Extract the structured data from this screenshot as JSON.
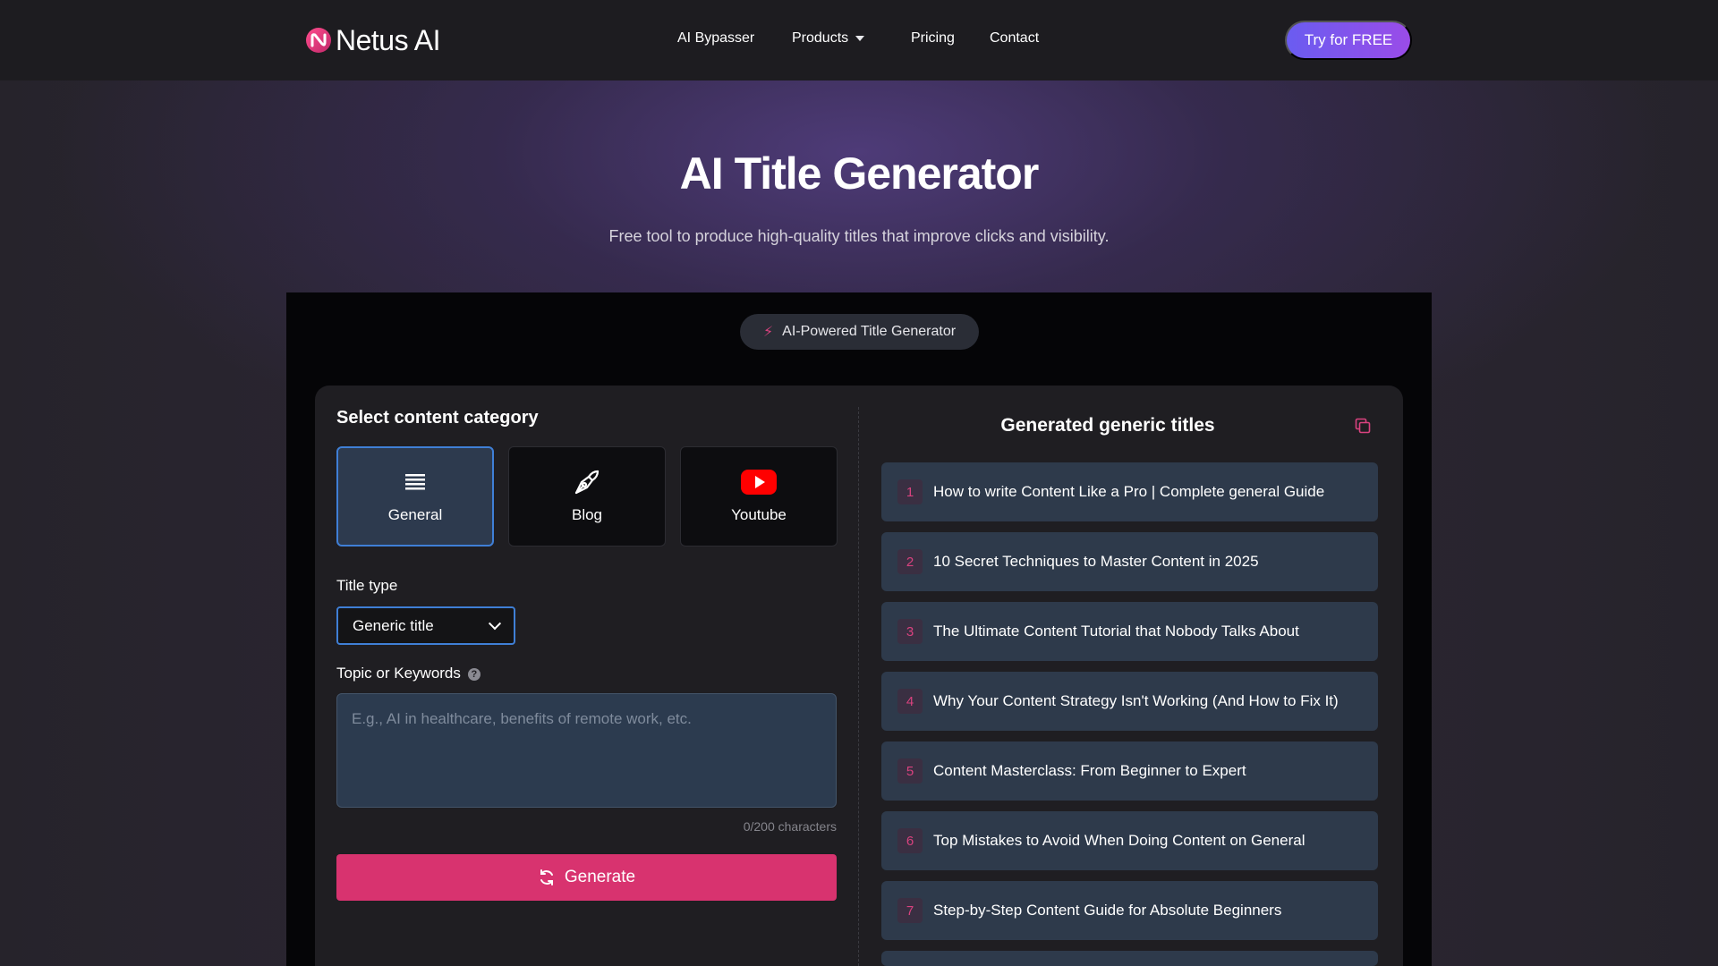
{
  "nav": {
    "brand": "Netus",
    "brand_suffix": "AI",
    "links": [
      "AI Bypasser",
      "Products",
      "Pricing",
      "Contact"
    ],
    "cta": "Try for FREE"
  },
  "hero": {
    "title": "AI Title Generator",
    "subtitle": "Free tool to produce high-quality titles that improve clicks and visibility."
  },
  "badge": {
    "icon": "bolt-icon",
    "label": "AI-Powered Title Generator"
  },
  "form": {
    "category_heading": "Select content category",
    "categories": [
      {
        "label": "General",
        "icon": "list-icon",
        "active": true
      },
      {
        "label": "Blog",
        "icon": "pen-nib-icon",
        "active": false
      },
      {
        "label": "Youtube",
        "icon": "youtube-icon",
        "active": false
      }
    ],
    "title_type_label": "Title type",
    "title_type_value": "Generic title",
    "topic_label": "Topic or Keywords",
    "topic_placeholder": "E.g., AI in healthcare, benefits of remote work, etc.",
    "char_count": "0/200 characters",
    "generate_label": "Generate"
  },
  "results": {
    "heading": "Generated generic titles",
    "items": [
      {
        "num": "1",
        "text": "How to write Content Like a Pro | Complete general Guide"
      },
      {
        "num": "2",
        "text": "10 Secret Techniques to Master Content in 2025"
      },
      {
        "num": "3",
        "text": "The Ultimate Content Tutorial that Nobody Talks About"
      },
      {
        "num": "4",
        "text": "Why Your Content Strategy Isn't Working (And How to Fix It)"
      },
      {
        "num": "5",
        "text": "Content Masterclass: From Beginner to Expert"
      },
      {
        "num": "6",
        "text": "Top Mistakes to Avoid When Doing Content on General"
      },
      {
        "num": "7",
        "text": "Step-by-Step Content Guide for Absolute Beginners"
      }
    ]
  },
  "colors": {
    "accent_pink": "#d8336f",
    "accent_blue": "#3f7fd6",
    "cta_start": "#6a5cf0",
    "cta_end": "#9a4ce8"
  }
}
